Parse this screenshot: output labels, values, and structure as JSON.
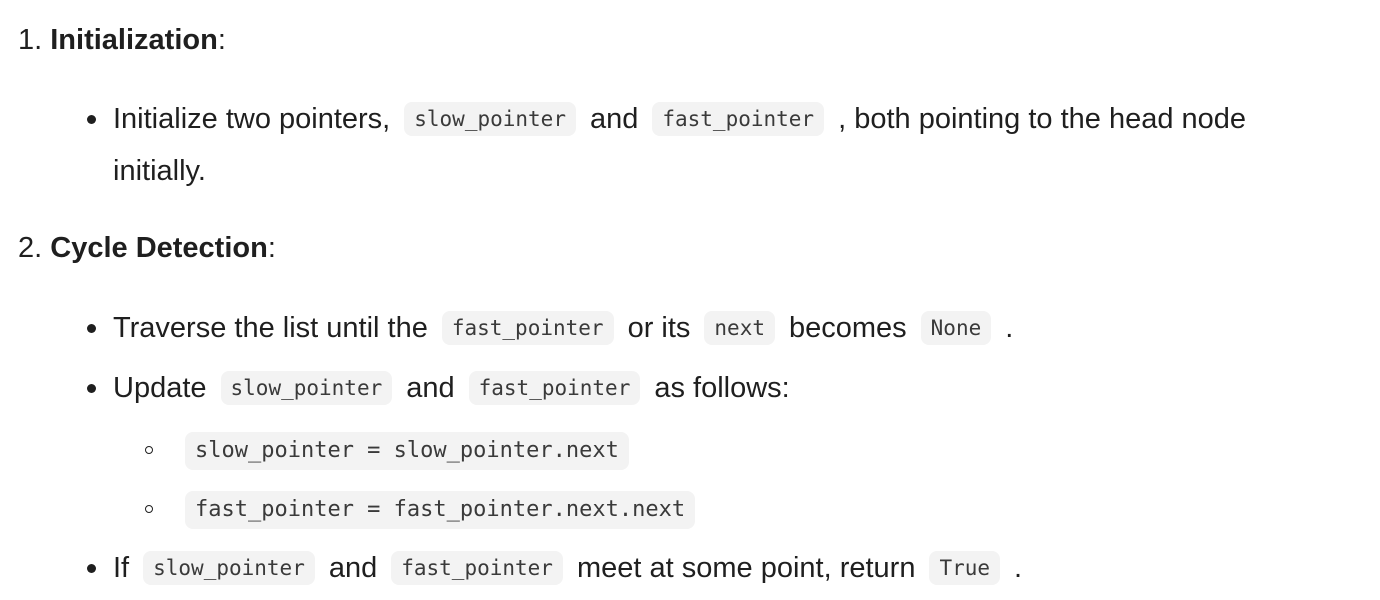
{
  "step1": {
    "number": "1.",
    "title": "Initialization",
    "colon": ":",
    "bullet1": {
      "t1": "Initialize two pointers,",
      "c1": "slow_pointer",
      "t2": "and",
      "c2": "fast_pointer",
      "t3": ", both pointing to the head node",
      "t4": "initially."
    }
  },
  "step2": {
    "number": "2.",
    "title": "Cycle Detection",
    "colon": ":",
    "bullet1": {
      "t1": "Traverse the list until the",
      "c1": "fast_pointer",
      "t2": "or its",
      "c2": "next",
      "t3": "becomes",
      "c3": "None",
      "t4": "."
    },
    "bullet2": {
      "t1": "Update",
      "c1": "slow_pointer",
      "t2": "and",
      "c2": "fast_pointer",
      "t3": "as follows:",
      "sub1": "slow_pointer = slow_pointer.next",
      "sub2": "fast_pointer = fast_pointer.next.next"
    },
    "bullet3": {
      "t1": "If",
      "c1": "slow_pointer",
      "t2": "and",
      "c2": "fast_pointer",
      "t3": "meet at some point, return",
      "c3": "True",
      "t4": "."
    }
  }
}
